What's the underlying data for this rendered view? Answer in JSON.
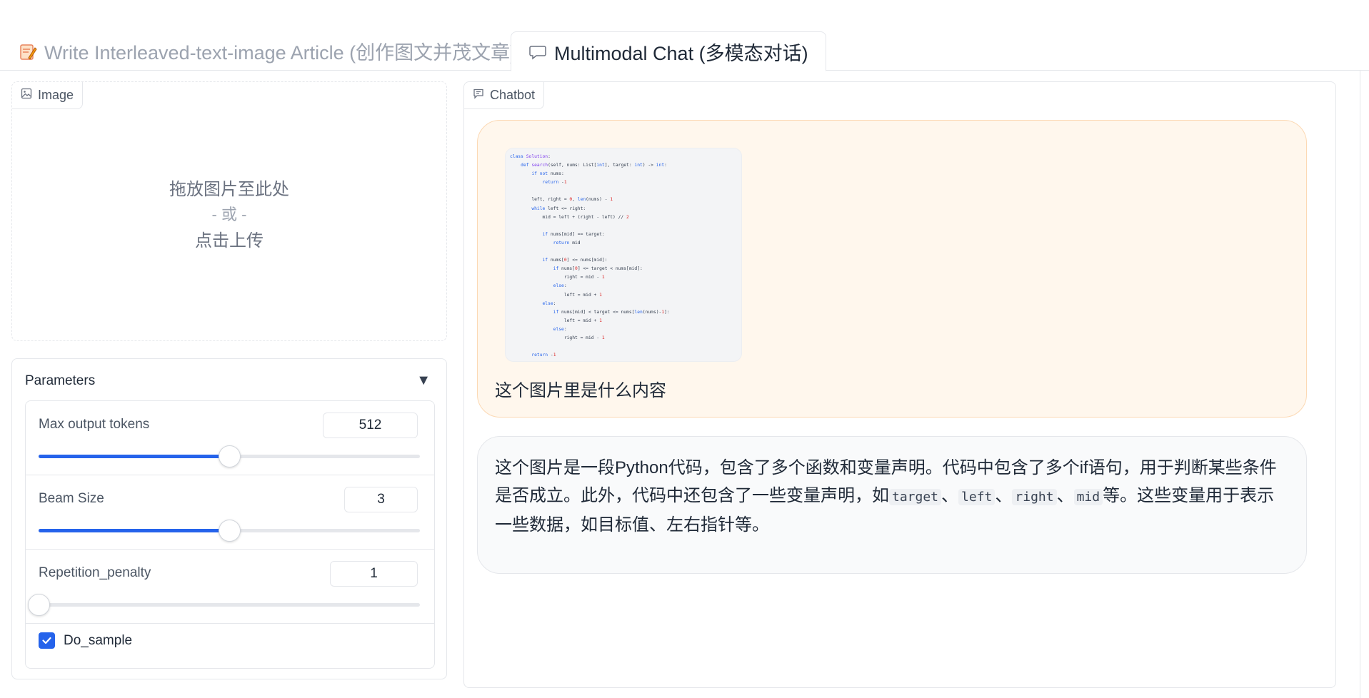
{
  "tabs": [
    {
      "label": "Write Interleaved-text-image Article (创作图文并茂文章)",
      "icon": "memo-icon"
    },
    {
      "label": "Multimodal Chat (多模态对话)",
      "icon": "speech-bubble-icon"
    }
  ],
  "image_panel": {
    "label": "Image",
    "upload_line1": "拖放图片至此处",
    "upload_line2": "- 或 -",
    "upload_line3": "点击上传"
  },
  "parameters": {
    "title": "Parameters",
    "toggle": "▼",
    "max_tokens": {
      "label": "Max output tokens",
      "value": "512",
      "fraction": 0.5
    },
    "beam_size": {
      "label": "Beam Size",
      "value": "3",
      "fraction": 0.5
    },
    "repetition_penalty": {
      "label": "Repetition_penalty",
      "value": "1",
      "fraction": 0.0
    },
    "do_sample": {
      "label": "Do_sample",
      "checked": true
    }
  },
  "chatbot": {
    "label": "Chatbot",
    "user_message": "这个图片里是什么内容",
    "bot_message": {
      "part1": "这个图片是一段Python代码，包含了多个函数和变量声明。代码中包含了多个if语句，用于判断某些条件是否成立。此外，代码中还包含了一些变量声明，如",
      "code_target": "target",
      "sep": "、",
      "code_left": "left",
      "code_right": "right",
      "code_mid": "mid",
      "part2": "等。这些变量用于表示一些数据，如目标值、左右指针等。"
    }
  },
  "colors": {
    "accent": "#2563eb",
    "user_bubble": "#fff7ed",
    "bot_bubble": "#f9fafb"
  }
}
